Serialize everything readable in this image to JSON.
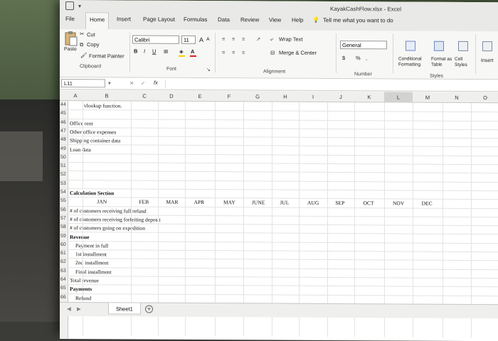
{
  "window": {
    "title": "KayakCashFlow.xlsx  -  Excel"
  },
  "tabs": [
    {
      "label": "File"
    },
    {
      "label": "Home"
    },
    {
      "label": "Insert"
    },
    {
      "label": "Page Layout"
    },
    {
      "label": "Formulas"
    },
    {
      "label": "Data"
    },
    {
      "label": "Review"
    },
    {
      "label": "View"
    },
    {
      "label": "Help"
    }
  ],
  "tell_me": "Tell me what you want to do",
  "clipboard": {
    "paste": "Paste",
    "cut": "Cut",
    "copy": "Copy",
    "format_painter": "Format Painter",
    "group": "Clipboard"
  },
  "font": {
    "name": "Calibri",
    "size": "11",
    "bold": "B",
    "italic": "I",
    "underline": "U",
    "group": "Font",
    "grow": "A",
    "shrink": "A"
  },
  "alignment": {
    "wrap": "Wrap Text",
    "merge": "Merge & Center",
    "group": "Alignment"
  },
  "number": {
    "format": "General",
    "currency": "$",
    "percent": "%",
    "comma": ",",
    "group": "Number"
  },
  "styles": {
    "conditional": "Conditional Formatting",
    "format_table": "Format as Table",
    "cell_styles": "Cell Styles",
    "group": "Styles"
  },
  "cells": {
    "insert": "Insert"
  },
  "formula_bar": {
    "name_box": "L11",
    "fx": "fx",
    "cancel": "✕",
    "enter": "✓"
  },
  "columns": [
    "A",
    "B",
    "C",
    "D",
    "E",
    "F",
    "G",
    "H",
    "I",
    "J",
    "K",
    "L",
    "M",
    "N",
    "O"
  ],
  "rows": [
    {
      "num": "44",
      "cells": [
        {
          "col": "B",
          "text": "vlookup function."
        }
      ]
    },
    {
      "num": "45",
      "cells": []
    },
    {
      "num": "46",
      "cells": [
        {
          "col": "A",
          "text": "Office rent"
        }
      ]
    },
    {
      "num": "47",
      "cells": [
        {
          "col": "A",
          "text": "Other office expenses"
        }
      ]
    },
    {
      "num": "48",
      "cells": [
        {
          "col": "A",
          "text": "Shipping container data"
        }
      ]
    },
    {
      "num": "49",
      "cells": [
        {
          "col": "A",
          "text": "Loan data"
        }
      ]
    },
    {
      "num": "50",
      "cells": []
    },
    {
      "num": "51",
      "cells": []
    },
    {
      "num": "52",
      "cells": []
    },
    {
      "num": "53",
      "cells": []
    },
    {
      "num": "54",
      "cells": [
        {
          "col": "A",
          "text": "Calculation Section",
          "bold": true
        }
      ]
    },
    {
      "num": "55",
      "cells": [
        {
          "col": "B",
          "text": "JAN"
        },
        {
          "col": "C",
          "text": "FEB"
        },
        {
          "col": "D",
          "text": "MAR"
        },
        {
          "col": "E",
          "text": "APR"
        },
        {
          "col": "F",
          "text": "MAY"
        },
        {
          "col": "G",
          "text": "JUNE"
        },
        {
          "col": "H",
          "text": "JUL"
        },
        {
          "col": "I",
          "text": "AUG"
        },
        {
          "col": "J",
          "text": "SEP"
        },
        {
          "col": "K",
          "text": "OCT"
        },
        {
          "col": "L",
          "text": "NOV"
        },
        {
          "col": "M",
          "text": "DEC"
        }
      ]
    },
    {
      "num": "56",
      "cells": [
        {
          "col": "A",
          "text": "# of customers receiving full refund"
        }
      ]
    },
    {
      "num": "57",
      "cells": [
        {
          "col": "A",
          "text": "# of customers receiving forfeiting deposit"
        }
      ]
    },
    {
      "num": "58",
      "cells": [
        {
          "col": "A",
          "text": "# of customers going on expedition"
        }
      ]
    },
    {
      "num": "59",
      "cells": [
        {
          "col": "A",
          "text": "Revenue",
          "bold": true
        }
      ]
    },
    {
      "num": "60",
      "cells": [
        {
          "col": "A",
          "text": "Payment in full",
          "indent": true
        }
      ]
    },
    {
      "num": "61",
      "cells": [
        {
          "col": "A",
          "text": "1st installment",
          "indent": true
        }
      ]
    },
    {
      "num": "62",
      "cells": [
        {
          "col": "A",
          "text": "2nd installment",
          "indent": true
        }
      ]
    },
    {
      "num": "63",
      "cells": [
        {
          "col": "A",
          "text": "Final installment",
          "indent": true
        }
      ]
    },
    {
      "num": "64",
      "cells": [
        {
          "col": "A",
          "text": "Total revenue"
        }
      ]
    },
    {
      "num": "65",
      "cells": [
        {
          "col": "A",
          "text": "Payments",
          "bold": true
        }
      ]
    },
    {
      "num": "66",
      "cells": [
        {
          "col": "A",
          "text": "Refund",
          "indent": true
        }
      ]
    }
  ],
  "sheet_tabs": {
    "active": "Sheet1",
    "add": "+"
  }
}
